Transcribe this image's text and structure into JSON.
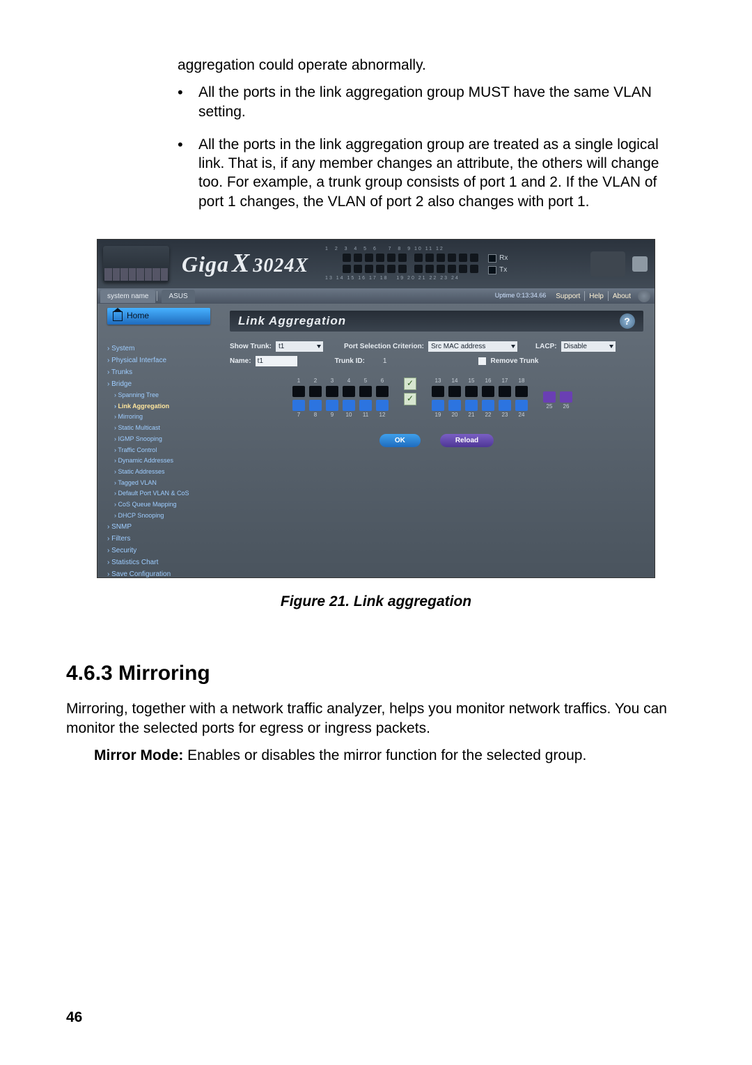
{
  "intro_frag": "aggregation could operate abnormally.",
  "bullets": [
    "All the ports in the link aggregation group MUST have the same VLAN setting.",
    "All the ports in the link aggregation group are treated as a single logical link. That is, if any member changes an attribute, the others will change too. For example, a trunk group consists of port 1 and 2. If the VLAN of port 1 changes, the VLAN of port 2 also changes with port 1."
  ],
  "figure_caption": "Figure 21.   Link aggregation",
  "section_head": "4.6.3    Mirroring",
  "para1": "Mirroring, together with a network traffic analyzer, helps you monitor network traffics. You can monitor the selected ports for egress or ingress packets.",
  "mirror_mode_b": "Mirror Mode:",
  "mirror_mode_t": " Enables or disables the mirror function for the selected group.",
  "page_number": "46",
  "shot": {
    "logo": "Giga",
    "logo_model": "3024X",
    "rx": "Rx",
    "tx": "Tx",
    "strip": {
      "tab1": "system name",
      "tab2": "ASUS",
      "status": "Uptime 0:13:34.66",
      "links": [
        "Support",
        "Help",
        "About"
      ]
    },
    "home": "Home",
    "nav": {
      "items": [
        "System",
        "Physical Interface",
        "Trunks",
        "Bridge"
      ],
      "subs": [
        "Spanning Tree",
        "Link Aggregation",
        "Mirroring",
        "Static Multicast",
        "IGMP Snooping",
        "Traffic Control",
        "Dynamic Addresses",
        "Static Addresses",
        "Tagged VLAN",
        "Default Port VLAN & CoS",
        "CoS Queue Mapping",
        "DHCP Snooping"
      ],
      "tail": [
        "SNMP",
        "Filters",
        "Security",
        "Statistics Chart",
        "Save Configuration"
      ]
    },
    "main": {
      "heading": "Link Aggregation",
      "show_trunk_lbl": "Show Trunk:",
      "show_trunk_val": "t1",
      "port_sel_lbl": "Port Selection Criterion:",
      "port_sel_val": "Src MAC address",
      "lacp_lbl": "LACP:",
      "lacp_val": "Disable",
      "name_lbl": "Name:",
      "name_val": "t1",
      "trunk_id_lbl": "Trunk ID:",
      "trunk_id_val": "1",
      "remove_lbl": "Remove Trunk",
      "top_ports_a": [
        "1",
        "2",
        "3",
        "4",
        "5",
        "6"
      ],
      "bot_ports_a": [
        "7",
        "8",
        "9",
        "10",
        "11",
        "12"
      ],
      "top_ports_b": [
        "13",
        "14",
        "15",
        "16",
        "17",
        "18"
      ],
      "bot_ports_b": [
        "19",
        "20",
        "21",
        "22",
        "23",
        "24"
      ],
      "fiber_ports_top": [
        "25",
        "26"
      ],
      "btn_ok": "OK",
      "btn_reload": "Reload"
    }
  }
}
